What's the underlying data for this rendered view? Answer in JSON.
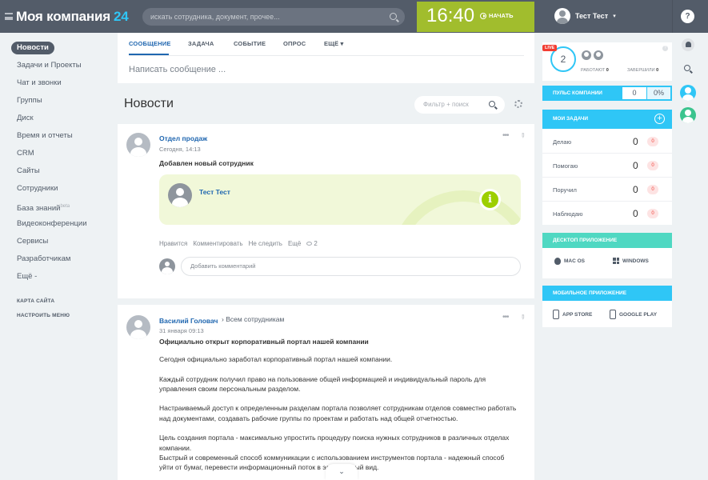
{
  "header": {
    "logo": "Моя компания",
    "logo_suffix": "24",
    "search_placeholder": "искать сотрудника, документ, прочее...",
    "clock": "16:40",
    "start_label": "НАЧАТЬ",
    "user_name": "Тест Тест",
    "help_label": "?",
    "accent_color": "#2fc6f6",
    "clock_bg": "#a1bd2d"
  },
  "sidebar": {
    "items": [
      {
        "label": "Новости"
      },
      {
        "label": "Задачи и Проекты"
      },
      {
        "label": "Чат и звонки"
      },
      {
        "label": "Группы"
      },
      {
        "label": "Диск"
      },
      {
        "label": "Время и отчеты"
      },
      {
        "label": "CRM"
      },
      {
        "label": "Сайты"
      },
      {
        "label": "Сотрудники"
      },
      {
        "label": "База знаний",
        "badge": "beta"
      },
      {
        "label": "Видеоконференции"
      },
      {
        "label": "Сервисы"
      },
      {
        "label": "Разработчикам"
      },
      {
        "label": "Ещё -"
      }
    ],
    "sitemap": "КАРТА САЙТА",
    "configure_menu": "НАСТРОИТЬ МЕНЮ"
  },
  "composer": {
    "tabs": [
      "СООБЩЕНИЕ",
      "ЗАДАЧА",
      "СОБЫТИЕ",
      "ОПРОС",
      "ЕЩЁ"
    ],
    "placeholder": "Написать сообщение ..."
  },
  "feed": {
    "title": "Новости",
    "filter_placeholder": "Фильтр + поиск",
    "posts": [
      {
        "author": "Отдел продаж",
        "time": "Сегодня, 14:13",
        "title": "Добавлен новый сотрудник",
        "new_user": "Тест Тест",
        "info_icon": "i",
        "actions": [
          "Нравится",
          "Комментировать",
          "Не следить",
          "Ещё"
        ],
        "views": "2",
        "comment_placeholder": "Добавить комментарий"
      },
      {
        "author": "Василий Головач",
        "recipient": "Всем сотрудникам",
        "time": "31 января 09:13",
        "title": "Официально открыт корпоративный портал нашей компании",
        "paragraphs": [
          "Сегодня официально заработал корпоративный портал нашей компании.",
          "Каждый сотрудник получил право на пользование общей информацией и индивидуальный пароль для управления своим персональным разделом.",
          "Настраиваемый доступ к определенным разделам портала позволяет сотрудникам отделов совместно работать над документами, создавать рабочие группы по проектам и работать над общей отчетностью.",
          "Цель создания портала - максимально упростить процедуру поиска нужных сотрудников в различных отделах компании.",
          "Быстрый и современный способ коммуникации с использованием инструментов портала - надежный способ уйти от бумаг, перевести информационный поток в электронный вид."
        ]
      }
    ]
  },
  "live": {
    "badge": "LIVE",
    "count": "2",
    "working_label": "РАБОТАЮТ",
    "working_value": "0",
    "finished_label": "ЗАВЕРШИЛИ",
    "finished_value": "0"
  },
  "pulse": {
    "label": "ПУЛЬС КОМПАНИИ",
    "value": "0",
    "percent": "0%"
  },
  "tasks": {
    "title": "МОИ ЗАДАЧИ",
    "rows": [
      {
        "label": "Делаю",
        "count": "0",
        "badge": "0"
      },
      {
        "label": "Помогаю",
        "count": "0",
        "badge": "0"
      },
      {
        "label": "Поручил",
        "count": "0",
        "badge": "0"
      },
      {
        "label": "Наблюдаю",
        "count": "0",
        "badge": "0"
      }
    ]
  },
  "desktop_app": {
    "title": "ДЕСКТОП ПРИЛОЖЕНИЕ",
    "mac": "MAC OS",
    "windows": "WINDOWS"
  },
  "mobile_app": {
    "title": "МОБИЛЬНОЕ ПРИЛОЖЕНИЕ",
    "appstore": "APP STORE",
    "googleplay": "GOOGLE PLAY"
  }
}
